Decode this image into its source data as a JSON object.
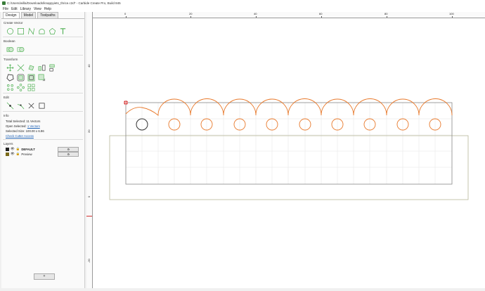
{
  "window": {
    "title": "C:/Users/willa/Downloads/knappyiets_thrice.c2d* - Carbide Create Pro, Build 845"
  },
  "menu": [
    "File",
    "Edit",
    "Library",
    "View",
    "Help"
  ],
  "tabs": [
    "Design",
    "Model",
    "Toolpaths"
  ],
  "sections": {
    "create_vector": "Create Vector",
    "boolean": "Boolean",
    "transform": "Transform",
    "edit": "Edit",
    "info": "Info",
    "layers": "Layers"
  },
  "info": {
    "total_selected_label": "Total Selected:",
    "total_selected_value": "11 Vectors",
    "open_selected_label": "Open Selected:",
    "open_selected_value": "1 Vectors",
    "selected_size_label": "Selected Size:",
    "selected_size_value": "100.00 x 6.96",
    "check_cutter_access": "Check Cutter Access"
  },
  "layers": [
    {
      "name": "DEFAULT",
      "color": "#222222",
      "button": "⚙"
    },
    {
      "name": "Preview",
      "color": "#7a6a1a",
      "button": "⚙"
    }
  ],
  "add_layer_label": "+",
  "rulers": {
    "x_labels": [
      "0",
      "20",
      "40",
      "60",
      "80",
      "100"
    ],
    "y_labels": [
      "40",
      "20",
      "0",
      "-20"
    ]
  },
  "colors": {
    "vector": "#e8782a",
    "selected": "#333333",
    "stock": "#b8b89a",
    "accent": "#d32f2f"
  }
}
